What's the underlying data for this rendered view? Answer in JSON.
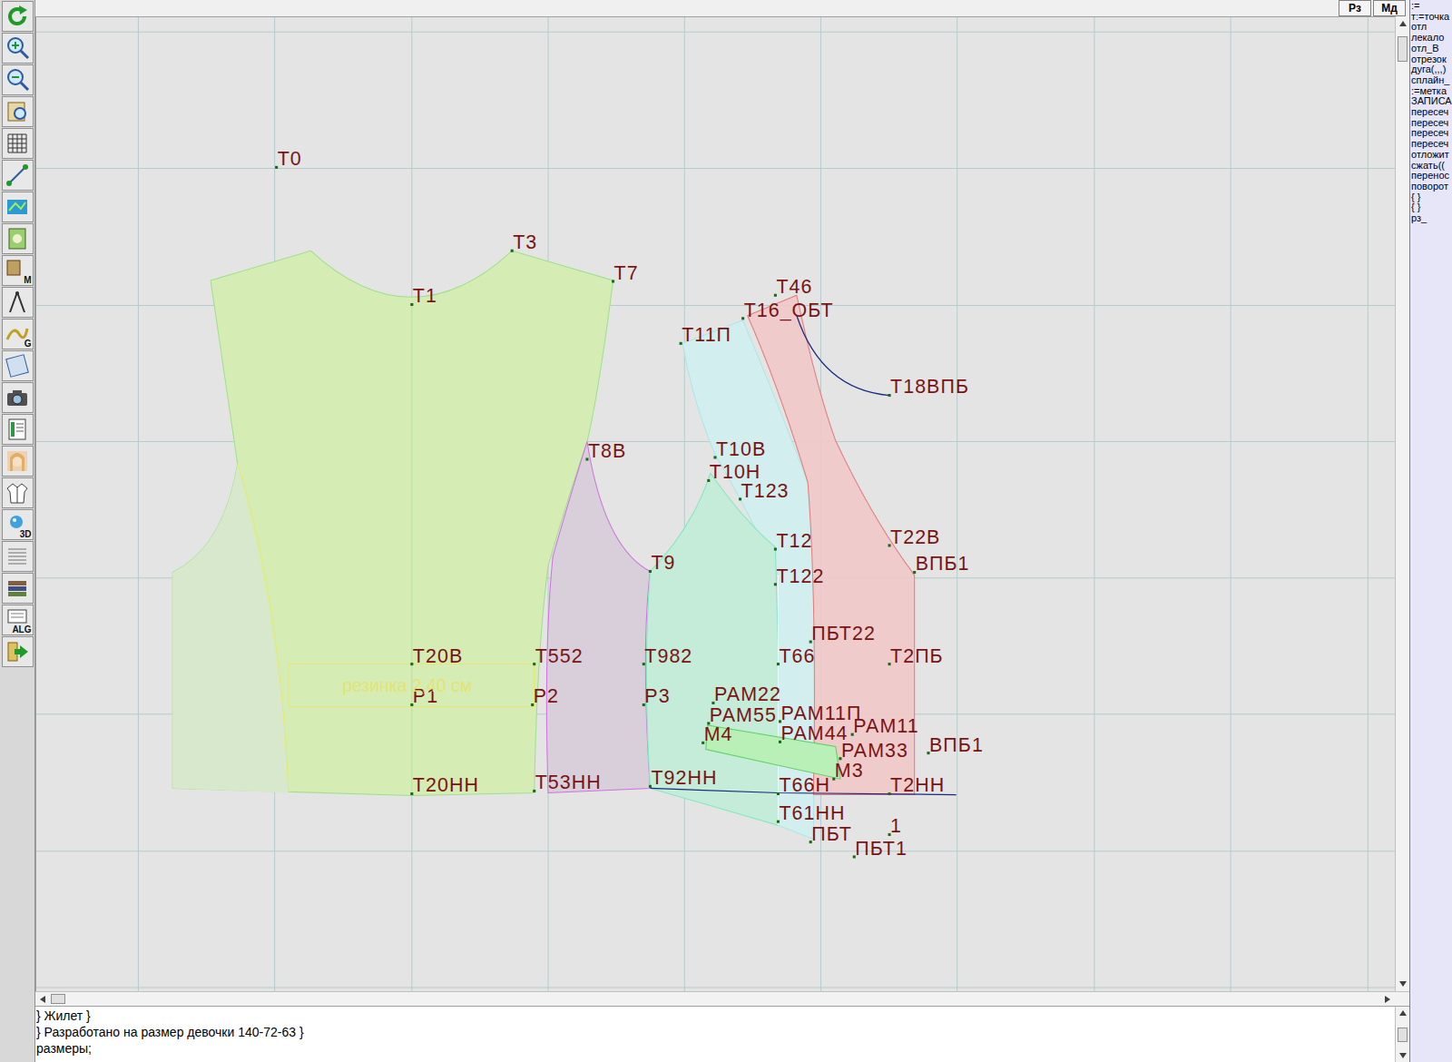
{
  "toolbar": {
    "buttons": [
      {
        "label": ""
      },
      {
        "label": ""
      },
      {
        "label": ""
      },
      {
        "label": ""
      },
      {
        "label": ""
      },
      {
        "label": ""
      },
      {
        "label": ""
      },
      {
        "label": ""
      },
      {
        "label": "M"
      },
      {
        "label": ""
      },
      {
        "label": "G"
      },
      {
        "label": ""
      },
      {
        "label": ""
      },
      {
        "label": ""
      },
      {
        "label": ""
      },
      {
        "label": ""
      },
      {
        "label": "3D"
      },
      {
        "label": ""
      },
      {
        "label": ""
      },
      {
        "label": "ALG"
      },
      {
        "label": ""
      }
    ]
  },
  "top_bar": {
    "buttons": [
      "Рз",
      "Мд"
    ]
  },
  "canvas": {
    "labels": [
      "Т0",
      "Т3",
      "Т7",
      "Т1",
      "Т46",
      "Т16_ОБТ",
      "Т11П",
      "Т18ВПБ",
      "Т8В",
      "Т10В",
      "Т10Н",
      "Т123",
      "Т12",
      "Т22В",
      "ВПБ1",
      "Т9",
      "Т122",
      "ПБТ22",
      "Т20В",
      "Т552",
      "Т982",
      "Т66",
      "Т2ПБ",
      "Р1",
      "Р2",
      "Р3",
      "РАМ22",
      "РАМ55",
      "РАМ11П",
      "М4",
      "РАМ44",
      "РАМ11",
      "РАМ33",
      "ВПБ1",
      "М3",
      "Т20НН",
      "Т53НН",
      "Т92НН",
      "Т66Н",
      "Т2НН",
      "Т61НН",
      "ПБТ",
      "1",
      "ПБТ1"
    ],
    "note": "резинка 2,40 см"
  },
  "right_panel": {
    "commands": [
      ":=",
      "т:=точка",
      "отл",
      "лекало",
      "отл_В",
      "отрезок",
      "дуга(,,,)",
      "сплайн_",
      ":=метка",
      "ЗАПИСА",
      "пересеч",
      "пересеч",
      "пересеч",
      "пересеч",
      "отложит",
      "сжать((",
      "перенос",
      "поворот",
      "{ }",
      "{ }",
      "рз_"
    ]
  },
  "editor": {
    "lines": [
      "} Жилет }",
      "} Разработано на размер девочки 140-72-63 }",
      "размеры;"
    ]
  }
}
